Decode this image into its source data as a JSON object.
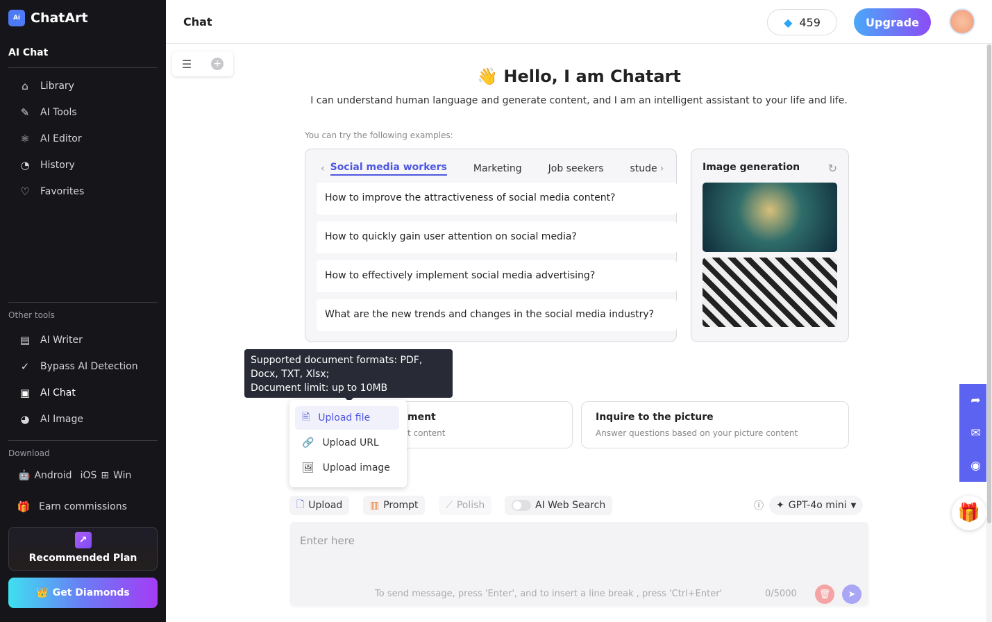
{
  "app": {
    "name": "ChatArt",
    "logo_text": "Ai"
  },
  "sidebar": {
    "section": "AI Chat",
    "items": [
      {
        "label": "Library",
        "icon": "home-icon"
      },
      {
        "label": "AI Tools",
        "icon": "pencil-icon"
      },
      {
        "label": "AI Editor",
        "icon": "atom-icon"
      },
      {
        "label": "History",
        "icon": "gauge-icon"
      },
      {
        "label": "Favorites",
        "icon": "heart-icon"
      }
    ],
    "other_label": "Other tools",
    "other": [
      {
        "label": "AI Writer",
        "icon": "document-icon"
      },
      {
        "label": "Bypass AI Detection",
        "icon": "check-circle-icon"
      },
      {
        "label": "AI Chat",
        "icon": "chat-icon",
        "active": true
      },
      {
        "label": "AI Image",
        "icon": "palette-icon"
      }
    ],
    "download_label": "Download",
    "downloads": [
      "Android",
      "iOS",
      "Win"
    ],
    "earn": "Earn commissions",
    "plan": "Recommended Plan",
    "diamonds": "Get Diamonds"
  },
  "header": {
    "title": "Chat",
    "diamonds": "459",
    "upgrade": "Upgrade"
  },
  "main": {
    "greeting_emoji": "👋",
    "greeting": "Hello, I am Chatart",
    "subtitle": "I can understand human language and generate content, and I am an intelligent assistant to your life and life.",
    "try_label": "You can try the following examples:",
    "tabs": [
      "Social media workers",
      "Marketing",
      "Job seekers",
      "stude"
    ],
    "questions": [
      "How to improve the attractiveness of social media content?",
      "How to quickly gain user attention on social media?",
      "How to effectively implement social media advertising?",
      "What are the new trends and changes in the social media industry?"
    ],
    "image_gen": "Image generation",
    "tooltip": [
      "Supported document formats: PDF,",
      "Docx, TXT, Xlsx;",
      "Document limit: up to 10MB"
    ],
    "card1": {
      "title": "ment",
      "desc": "t content"
    },
    "card2": {
      "title": "Inquire to the picture",
      "desc": "Answer questions based on your picture content"
    },
    "upload_menu": [
      "Upload file",
      "Upload URL",
      "Upload image"
    ],
    "toolbar": {
      "upload": "Upload",
      "prompt": "Prompt",
      "polish": "Polish",
      "web_search": "AI Web Search",
      "web_search_on": false,
      "model": "GPT-4o mini"
    },
    "input": {
      "placeholder": "Enter here",
      "hint": "To send message, press 'Enter', and to insert a line break , press 'Ctrl+Enter'",
      "count": "0/5000"
    }
  },
  "colors": {
    "sidebar": "#161519",
    "accent": "#4e57e0",
    "side_panel": "#5b63f0"
  }
}
